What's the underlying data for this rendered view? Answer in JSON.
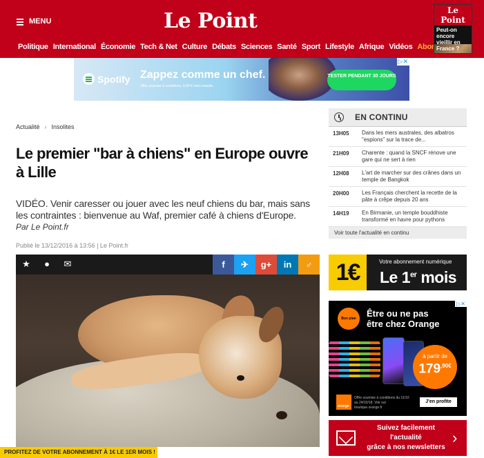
{
  "header": {
    "menu_label": "MENU",
    "logo": "Le Point",
    "nav": [
      "Politique",
      "International",
      "Économie",
      "Tech & Net",
      "Culture",
      "Débats",
      "Sciences",
      "Santé",
      "Sport",
      "Lifestyle",
      "Afrique",
      "Vidéos",
      "Abonnés"
    ],
    "magazine": {
      "title": "Le Point",
      "headline": "Peut-on encore vieillir en France ?"
    },
    "nav_highlight_color": "#f6b12e",
    "brand_color": "#c1001a"
  },
  "top_ad": {
    "brand": "Spotify",
    "headline": "Zappez comme un chef.",
    "subline": "Offre soumise à conditions. 9,99 € mois ensuite.",
    "cta": "TESTER PENDANT 30 JOURS",
    "adchoices": "▷✕"
  },
  "article": {
    "breadcrumb": [
      "Actualité",
      "Insolites"
    ],
    "title": "Le premier \"bar à chiens\" en Europe ouvre à Lille",
    "lede": "VIDÉO. Venir caresser ou jouer avec les neuf chiens du bar, mais sans les contraintes : bienvenue au Waf, premier café à chiens d'Europe.",
    "byline": "Par Le Point.fr",
    "meta": "Publié le 13/12/2016 à 13:56 | Le Point.fr",
    "share": {
      "left_icons": [
        "star-icon",
        "comment-icon",
        "mail-icon"
      ],
      "right_buttons": [
        {
          "name": "facebook",
          "glyph": "f",
          "color": "#3b5998"
        },
        {
          "name": "twitter",
          "glyph": "🐦",
          "color": "#1da1f2"
        },
        {
          "name": "google-plus",
          "glyph": "g+",
          "color": "#dd4b39"
        },
        {
          "name": "linkedin",
          "glyph": "in",
          "color": "#0077b5"
        },
        {
          "name": "more",
          "glyph": "♂",
          "color": "#f39c12"
        }
      ]
    },
    "promo_strip": "PROFITEZ DE VOTRE ABONNEMENT À 1€ LE 1ER MOIS !"
  },
  "continu": {
    "title": "EN CONTINU",
    "items": [
      {
        "time": "13H05",
        "text": "Dans les mers australes, des albatros \"espions\" sur la trace de..."
      },
      {
        "time": "21H09",
        "text": "Charente : quand la SNCF rénove une gare qui ne sert à rien"
      },
      {
        "time": "12H08",
        "text": "L'art de marcher sur des crânes dans un temple de Bangkok"
      },
      {
        "time": "20H00",
        "text": "Les Français cherchent la recette de la pâte à crêpe depuis 20 ans"
      },
      {
        "time": "14H19",
        "text": "En Birmanie, un temple bouddhiste transformé en havre pour pythons"
      }
    ],
    "more": "Voir toute l'actualité en continu"
  },
  "ad_1euro": {
    "box": "1€",
    "top": "Votre abonnement numérique",
    "big": "Le 1",
    "sup": "er",
    "tail": " mois"
  },
  "ad_orange": {
    "bon_plan": "Bon plan",
    "title_line1": "Être ou ne pas",
    "title_line2": "être chez Orange",
    "price_label": "à partir de",
    "price": "179",
    "price_cents": ",90€",
    "logo": "orange",
    "fine": "Offre soumise à conditions du 11/10 au 24/10/18. Voir sur boutique.orange.fr",
    "cta": "J'en profite"
  },
  "newsletter": {
    "line1": "Suivez facilement l'actualité",
    "line2": "grâce à nos newsletters",
    "chevron": "›"
  }
}
